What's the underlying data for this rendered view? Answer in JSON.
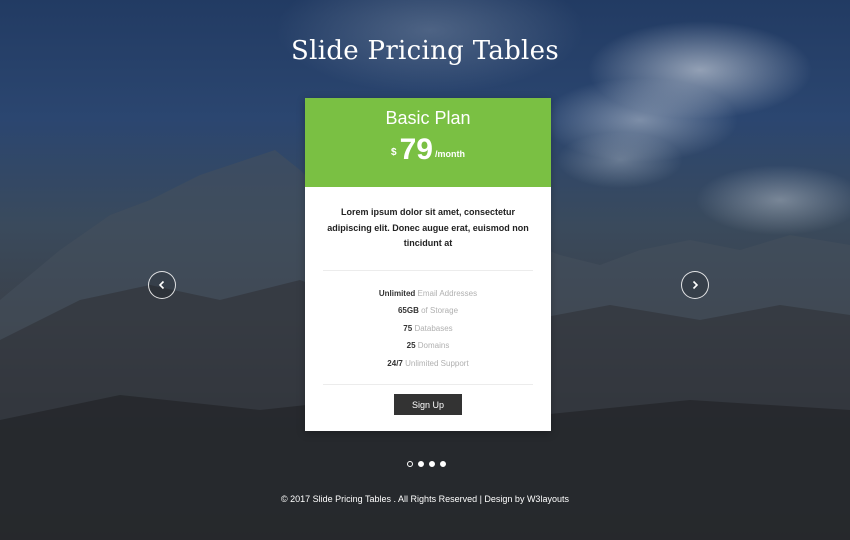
{
  "page": {
    "title": "Slide Pricing Tables"
  },
  "plan": {
    "name": "Basic Plan",
    "currency": "$",
    "amount": "79",
    "period": "/month",
    "description": "Lorem ipsum dolor sit amet, consectetur adipiscing elit. Donec augue erat, euismod non tincidunt at",
    "features": [
      {
        "strong": "Unlimited",
        "rest": "Email Addresses"
      },
      {
        "strong": "65GB",
        "rest": "of Storage"
      },
      {
        "strong": "75",
        "rest": "Databases"
      },
      {
        "strong": "25",
        "rest": "Domains"
      },
      {
        "strong": "24/7",
        "rest": "Unlimited Support"
      }
    ],
    "signup_label": "Sign Up"
  },
  "carousel": {
    "prev_icon": "chevron-left-icon",
    "next_icon": "chevron-right-icon",
    "dots": [
      "inactive",
      "active",
      "active",
      "active"
    ]
  },
  "footer": {
    "text": "© 2017 Slide Pricing Tables . All Rights Reserved | Design by W3layouts"
  },
  "colors": {
    "accent": "#7ac043",
    "button": "#333333",
    "text_dark": "#222222",
    "text_muted": "#b0b0b0"
  }
}
